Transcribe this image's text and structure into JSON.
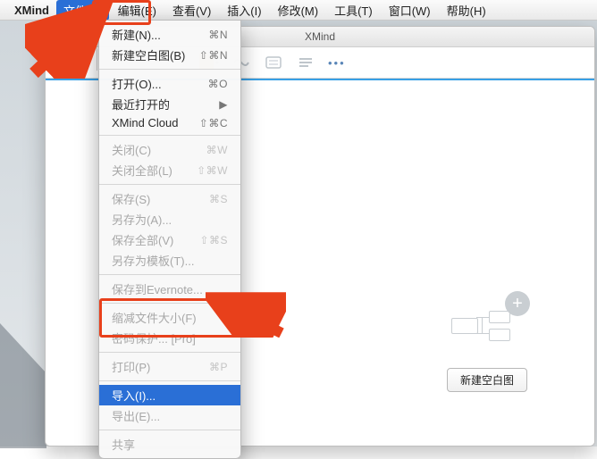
{
  "menubar": {
    "app": "XMind",
    "items": [
      "文件(F)",
      "编辑(E)",
      "查看(V)",
      "插入(I)",
      "修改(M)",
      "工具(T)",
      "窗口(W)",
      "帮助(H)"
    ],
    "selected_index": 0
  },
  "window": {
    "title": "XMind",
    "placeholder_button": "新建空白图"
  },
  "dropdown": {
    "groups": [
      [
        {
          "label": "新建(N)...",
          "shortcut": "⌘N",
          "enabled": true
        },
        {
          "label": "新建空白图(B)",
          "shortcut": "⇧⌘N",
          "enabled": true
        }
      ],
      [
        {
          "label": "打开(O)...",
          "shortcut": "⌘O",
          "enabled": true
        },
        {
          "label": "最近打开的",
          "shortcut": "▶",
          "enabled": true
        },
        {
          "label": "XMind Cloud",
          "shortcut": "⇧⌘C",
          "enabled": true
        }
      ],
      [
        {
          "label": "关闭(C)",
          "shortcut": "⌘W",
          "enabled": false
        },
        {
          "label": "关闭全部(L)",
          "shortcut": "⇧⌘W",
          "enabled": false
        }
      ],
      [
        {
          "label": "保存(S)",
          "shortcut": "⌘S",
          "enabled": false
        },
        {
          "label": "另存为(A)...",
          "shortcut": "",
          "enabled": false
        },
        {
          "label": "保存全部(V)",
          "shortcut": "⇧⌘S",
          "enabled": false
        },
        {
          "label": "另存为模板(T)...",
          "shortcut": "",
          "enabled": false
        }
      ],
      [
        {
          "label": "保存到Evernote...",
          "shortcut": "",
          "enabled": false
        }
      ],
      [
        {
          "label": "缩减文件大小(F)",
          "shortcut": "",
          "enabled": false
        },
        {
          "label": "密码保护... [Pro]",
          "shortcut": "",
          "enabled": false
        }
      ],
      [
        {
          "label": "打印(P)",
          "shortcut": "⌘P",
          "enabled": false
        }
      ],
      [
        {
          "label": "导入(I)...",
          "shortcut": "",
          "enabled": true,
          "selected": true
        },
        {
          "label": "导出(E)...",
          "shortcut": "",
          "enabled": false
        }
      ],
      [
        {
          "label": "共享",
          "shortcut": "",
          "enabled": false
        }
      ]
    ]
  }
}
